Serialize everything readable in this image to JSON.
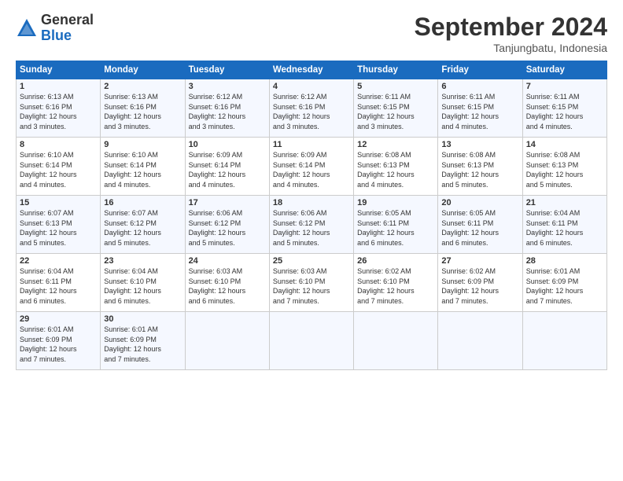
{
  "logo": {
    "general": "General",
    "blue": "Blue"
  },
  "title": "September 2024",
  "location": "Tanjungbatu, Indonesia",
  "days_header": [
    "Sunday",
    "Monday",
    "Tuesday",
    "Wednesday",
    "Thursday",
    "Friday",
    "Saturday"
  ],
  "weeks": [
    [
      {
        "day": "1",
        "detail": "Sunrise: 6:13 AM\nSunset: 6:16 PM\nDaylight: 12 hours\nand 3 minutes."
      },
      {
        "day": "2",
        "detail": "Sunrise: 6:13 AM\nSunset: 6:16 PM\nDaylight: 12 hours\nand 3 minutes."
      },
      {
        "day": "3",
        "detail": "Sunrise: 6:12 AM\nSunset: 6:16 PM\nDaylight: 12 hours\nand 3 minutes."
      },
      {
        "day": "4",
        "detail": "Sunrise: 6:12 AM\nSunset: 6:16 PM\nDaylight: 12 hours\nand 3 minutes."
      },
      {
        "day": "5",
        "detail": "Sunrise: 6:11 AM\nSunset: 6:15 PM\nDaylight: 12 hours\nand 3 minutes."
      },
      {
        "day": "6",
        "detail": "Sunrise: 6:11 AM\nSunset: 6:15 PM\nDaylight: 12 hours\nand 4 minutes."
      },
      {
        "day": "7",
        "detail": "Sunrise: 6:11 AM\nSunset: 6:15 PM\nDaylight: 12 hours\nand 4 minutes."
      }
    ],
    [
      {
        "day": "8",
        "detail": "Sunrise: 6:10 AM\nSunset: 6:14 PM\nDaylight: 12 hours\nand 4 minutes."
      },
      {
        "day": "9",
        "detail": "Sunrise: 6:10 AM\nSunset: 6:14 PM\nDaylight: 12 hours\nand 4 minutes."
      },
      {
        "day": "10",
        "detail": "Sunrise: 6:09 AM\nSunset: 6:14 PM\nDaylight: 12 hours\nand 4 minutes."
      },
      {
        "day": "11",
        "detail": "Sunrise: 6:09 AM\nSunset: 6:14 PM\nDaylight: 12 hours\nand 4 minutes."
      },
      {
        "day": "12",
        "detail": "Sunrise: 6:08 AM\nSunset: 6:13 PM\nDaylight: 12 hours\nand 4 minutes."
      },
      {
        "day": "13",
        "detail": "Sunrise: 6:08 AM\nSunset: 6:13 PM\nDaylight: 12 hours\nand 5 minutes."
      },
      {
        "day": "14",
        "detail": "Sunrise: 6:08 AM\nSunset: 6:13 PM\nDaylight: 12 hours\nand 5 minutes."
      }
    ],
    [
      {
        "day": "15",
        "detail": "Sunrise: 6:07 AM\nSunset: 6:13 PM\nDaylight: 12 hours\nand 5 minutes."
      },
      {
        "day": "16",
        "detail": "Sunrise: 6:07 AM\nSunset: 6:12 PM\nDaylight: 12 hours\nand 5 minutes."
      },
      {
        "day": "17",
        "detail": "Sunrise: 6:06 AM\nSunset: 6:12 PM\nDaylight: 12 hours\nand 5 minutes."
      },
      {
        "day": "18",
        "detail": "Sunrise: 6:06 AM\nSunset: 6:12 PM\nDaylight: 12 hours\nand 5 minutes."
      },
      {
        "day": "19",
        "detail": "Sunrise: 6:05 AM\nSunset: 6:11 PM\nDaylight: 12 hours\nand 6 minutes."
      },
      {
        "day": "20",
        "detail": "Sunrise: 6:05 AM\nSunset: 6:11 PM\nDaylight: 12 hours\nand 6 minutes."
      },
      {
        "day": "21",
        "detail": "Sunrise: 6:04 AM\nSunset: 6:11 PM\nDaylight: 12 hours\nand 6 minutes."
      }
    ],
    [
      {
        "day": "22",
        "detail": "Sunrise: 6:04 AM\nSunset: 6:11 PM\nDaylight: 12 hours\nand 6 minutes."
      },
      {
        "day": "23",
        "detail": "Sunrise: 6:04 AM\nSunset: 6:10 PM\nDaylight: 12 hours\nand 6 minutes."
      },
      {
        "day": "24",
        "detail": "Sunrise: 6:03 AM\nSunset: 6:10 PM\nDaylight: 12 hours\nand 6 minutes."
      },
      {
        "day": "25",
        "detail": "Sunrise: 6:03 AM\nSunset: 6:10 PM\nDaylight: 12 hours\nand 7 minutes."
      },
      {
        "day": "26",
        "detail": "Sunrise: 6:02 AM\nSunset: 6:10 PM\nDaylight: 12 hours\nand 7 minutes."
      },
      {
        "day": "27",
        "detail": "Sunrise: 6:02 AM\nSunset: 6:09 PM\nDaylight: 12 hours\nand 7 minutes."
      },
      {
        "day": "28",
        "detail": "Sunrise: 6:01 AM\nSunset: 6:09 PM\nDaylight: 12 hours\nand 7 minutes."
      }
    ],
    [
      {
        "day": "29",
        "detail": "Sunrise: 6:01 AM\nSunset: 6:09 PM\nDaylight: 12 hours\nand 7 minutes."
      },
      {
        "day": "30",
        "detail": "Sunrise: 6:01 AM\nSunset: 6:09 PM\nDaylight: 12 hours\nand 7 minutes."
      },
      {
        "day": "",
        "detail": ""
      },
      {
        "day": "",
        "detail": ""
      },
      {
        "day": "",
        "detail": ""
      },
      {
        "day": "",
        "detail": ""
      },
      {
        "day": "",
        "detail": ""
      }
    ]
  ]
}
